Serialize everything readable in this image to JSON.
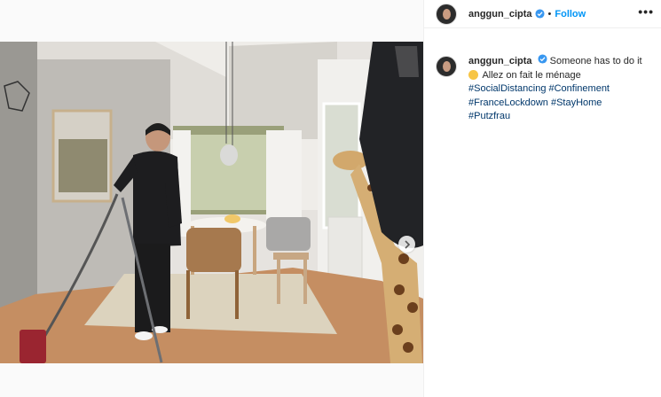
{
  "header": {
    "username": "anggun_cipta",
    "separator": "•",
    "follow_label": "Follow",
    "more_label": "•••"
  },
  "caption": {
    "username": "anggun_cipta",
    "text_line1": "Someone has to do it",
    "text_line2": "Allez on fait le ménage",
    "emoji": "grinning-sweat-emoji",
    "hashtags": [
      "#SocialDistancing",
      "#Confinement",
      "#FranceLockdown",
      "#StayHome",
      "#Putzfrau"
    ]
  },
  "colors": {
    "link_blue": "#0095f6",
    "hashtag": "#00376b",
    "verified_blue": "#3897f0"
  },
  "icons": {
    "verified": "verified-badge-icon",
    "next": "chevron-right-icon",
    "more": "more-options-icon"
  }
}
